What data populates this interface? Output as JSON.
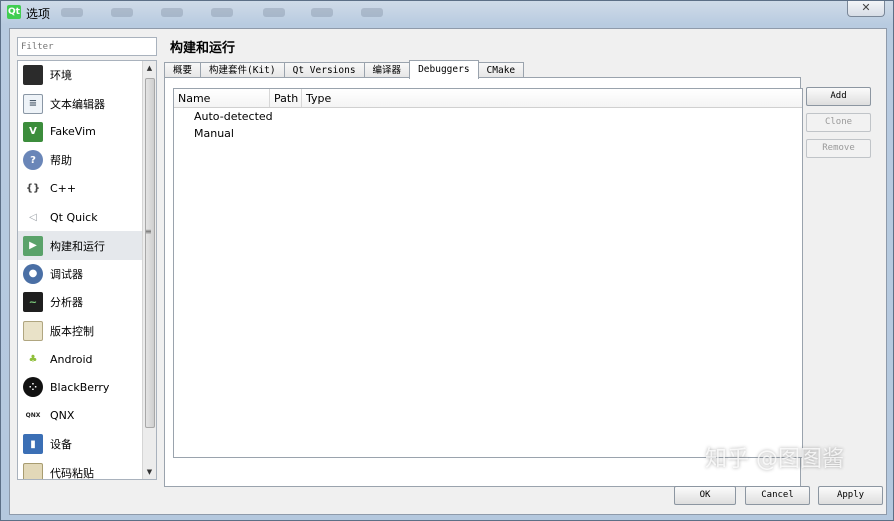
{
  "window": {
    "title": "选项",
    "app_icon_text": "Qt",
    "close_symbol": "✕"
  },
  "filter": {
    "placeholder": "Filter"
  },
  "sidebar": {
    "items": [
      {
        "label": "环境",
        "icon": "monitor-icon"
      },
      {
        "label": "文本编辑器",
        "icon": "text-editor-icon"
      },
      {
        "label": "FakeVim",
        "icon": "fakevim-icon"
      },
      {
        "label": "帮助",
        "icon": "help-icon"
      },
      {
        "label": "C++",
        "icon": "braces-icon"
      },
      {
        "label": "Qt Quick",
        "icon": "qt-quick-icon"
      },
      {
        "label": "构建和运行",
        "icon": "build-run-icon",
        "selected": true
      },
      {
        "label": "调试器",
        "icon": "debugger-icon"
      },
      {
        "label": "分析器",
        "icon": "analyzer-icon"
      },
      {
        "label": "版本控制",
        "icon": "version-control-icon"
      },
      {
        "label": "Android",
        "icon": "android-icon"
      },
      {
        "label": "BlackBerry",
        "icon": "blackberry-icon"
      },
      {
        "label": "QNX",
        "icon": "qnx-icon"
      },
      {
        "label": "设备",
        "icon": "device-icon"
      },
      {
        "label": "代码粘贴",
        "icon": "code-paste-icon"
      }
    ]
  },
  "page": {
    "title": "构建和运行"
  },
  "tabs": [
    {
      "label": "概要"
    },
    {
      "label": "构建套件(Kit)"
    },
    {
      "label": "Qt Versions"
    },
    {
      "label": "编译器"
    },
    {
      "label": "Debuggers",
      "active": true
    },
    {
      "label": "CMake"
    }
  ],
  "tree": {
    "columns": [
      "Name",
      "Path",
      "Type"
    ],
    "rows": [
      "Auto-detected",
      "Manual"
    ]
  },
  "actions": {
    "add": "Add",
    "clone": "Clone",
    "remove": "Remove"
  },
  "dialog_buttons": {
    "ok": "OK",
    "cancel": "Cancel",
    "apply": "Apply"
  },
  "watermark": "知乎 @图图酱",
  "colors": {
    "titlebar": "#b8cbe0",
    "selection": "#e5e8ec",
    "qt_green": "#41cd52"
  }
}
